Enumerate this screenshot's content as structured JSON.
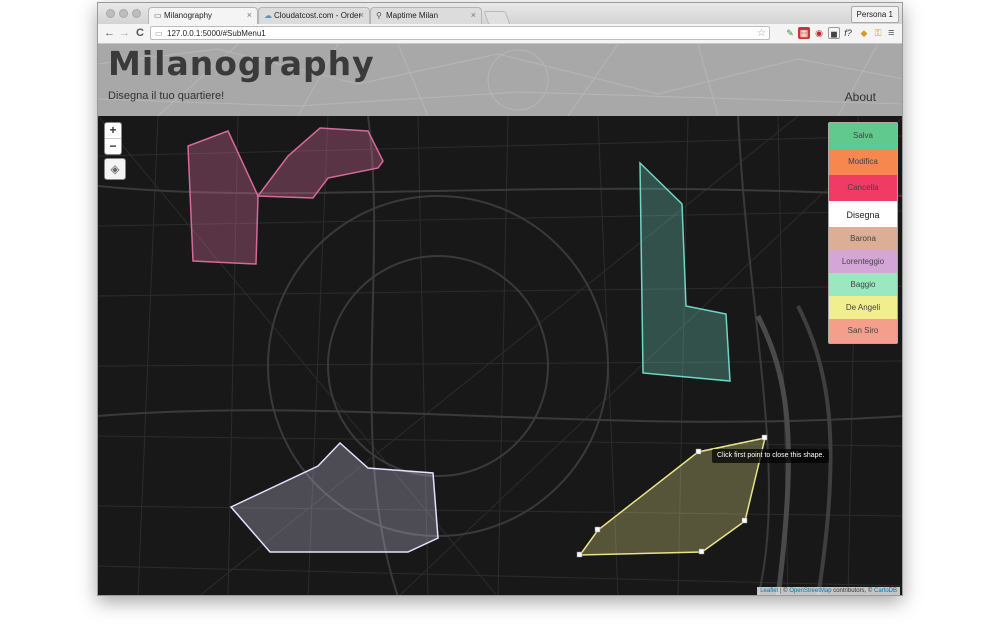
{
  "browser": {
    "tabs": [
      {
        "label": "Milanography",
        "icon": "page-icon",
        "close": "×"
      },
      {
        "label": "Cloudatcost.com - Order",
        "icon": "cloud-icon",
        "close": "×"
      },
      {
        "label": "Maptime Milan",
        "icon": "map-pin-icon",
        "close": "×"
      }
    ],
    "profile": "Persona 1",
    "url": "127.0.0.1:5000/#SubMenu1",
    "nav": {
      "back": "←",
      "forward": "→",
      "reload": "C",
      "menu": "≡",
      "star": "☆"
    }
  },
  "site": {
    "title": "Milanography",
    "tagline": "Disegna il tuo quartiere!",
    "about": "About"
  },
  "map": {
    "zoom_in": "+",
    "zoom_out": "−",
    "tooltip": "Click first point to close this shape.",
    "attribution": {
      "leaflet": "Leaflet",
      "sep1": " | © ",
      "osm": "OpenStreetMap",
      "mid": " contributors, © ",
      "cartodb": "CartoDB"
    }
  },
  "panel": {
    "actions": [
      {
        "label": "Salva",
        "color": "#5fc98e"
      },
      {
        "label": "Modifica",
        "color": "#f5874f"
      },
      {
        "label": "Cancella",
        "color": "#f03c64"
      }
    ],
    "draw_label": "Disegna",
    "quartieri": [
      {
        "label": "Barona",
        "color": "#dcae96"
      },
      {
        "label": "Lorenteggio",
        "color": "#d4a6d8"
      },
      {
        "label": "Baggio",
        "color": "#9be8c0"
      },
      {
        "label": "De Angeli",
        "color": "#f1ee8e"
      },
      {
        "label": "San Siro",
        "color": "#f59e8b"
      }
    ]
  },
  "colors": {
    "pink_shape": "#d46a9a",
    "teal_shape": "#6fd6c4",
    "lilac_shape": "#d8d0f0",
    "yellow_shape": "#e8e48a"
  }
}
